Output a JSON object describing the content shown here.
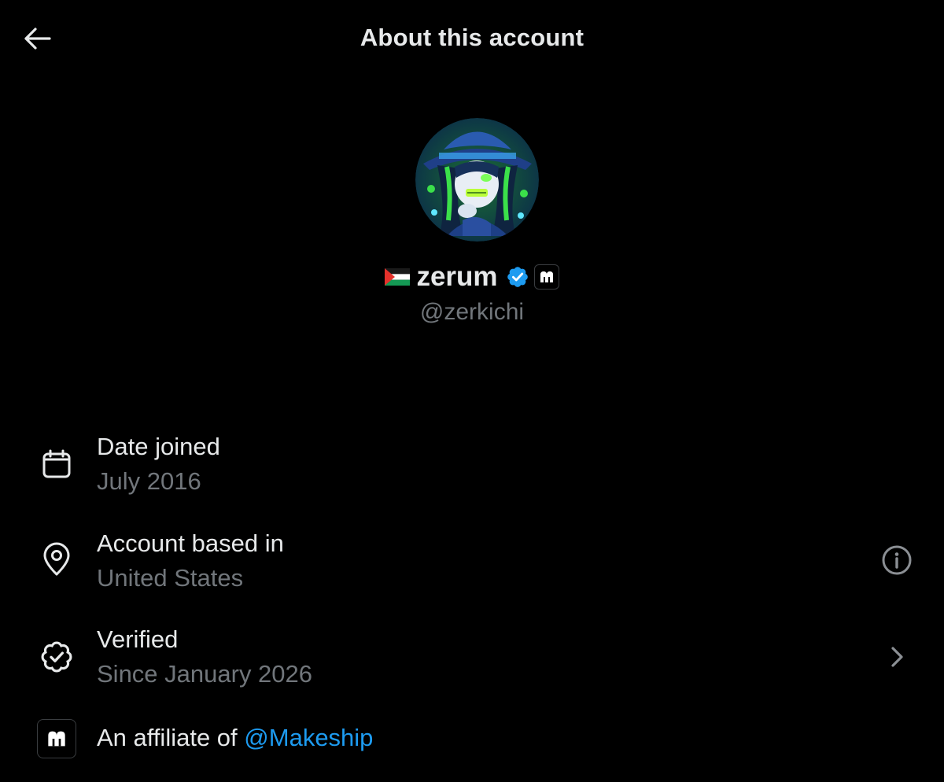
{
  "header": {
    "title": "About this account",
    "back_icon": "arrow-left-icon"
  },
  "profile": {
    "display_name": "zerum",
    "name_prefix_emoji": "palestine-flag",
    "handle": "@zerkichi",
    "verified": true,
    "verified_color": "#1d9bf0",
    "affiliate_badge": "makeship-logo"
  },
  "rows": {
    "date_joined": {
      "icon": "calendar-icon",
      "title": "Date joined",
      "value": "July 2016"
    },
    "location": {
      "icon": "location-pin-icon",
      "title": "Account based in",
      "value": "United States",
      "trailing_icon": "info-icon"
    },
    "verified": {
      "icon": "verified-check-icon",
      "title": "Verified",
      "value": "Since January 2026",
      "trailing_icon": "chevron-right-icon"
    },
    "affiliate": {
      "icon": "makeship-logo",
      "prefix": "An affiliate of ",
      "link": "@Makeship",
      "link_color": "#1d9bf0"
    }
  },
  "colors": {
    "background": "#000000",
    "primary_text": "#e7e9ea",
    "secondary_text": "#71767b",
    "accent": "#1d9bf0"
  }
}
